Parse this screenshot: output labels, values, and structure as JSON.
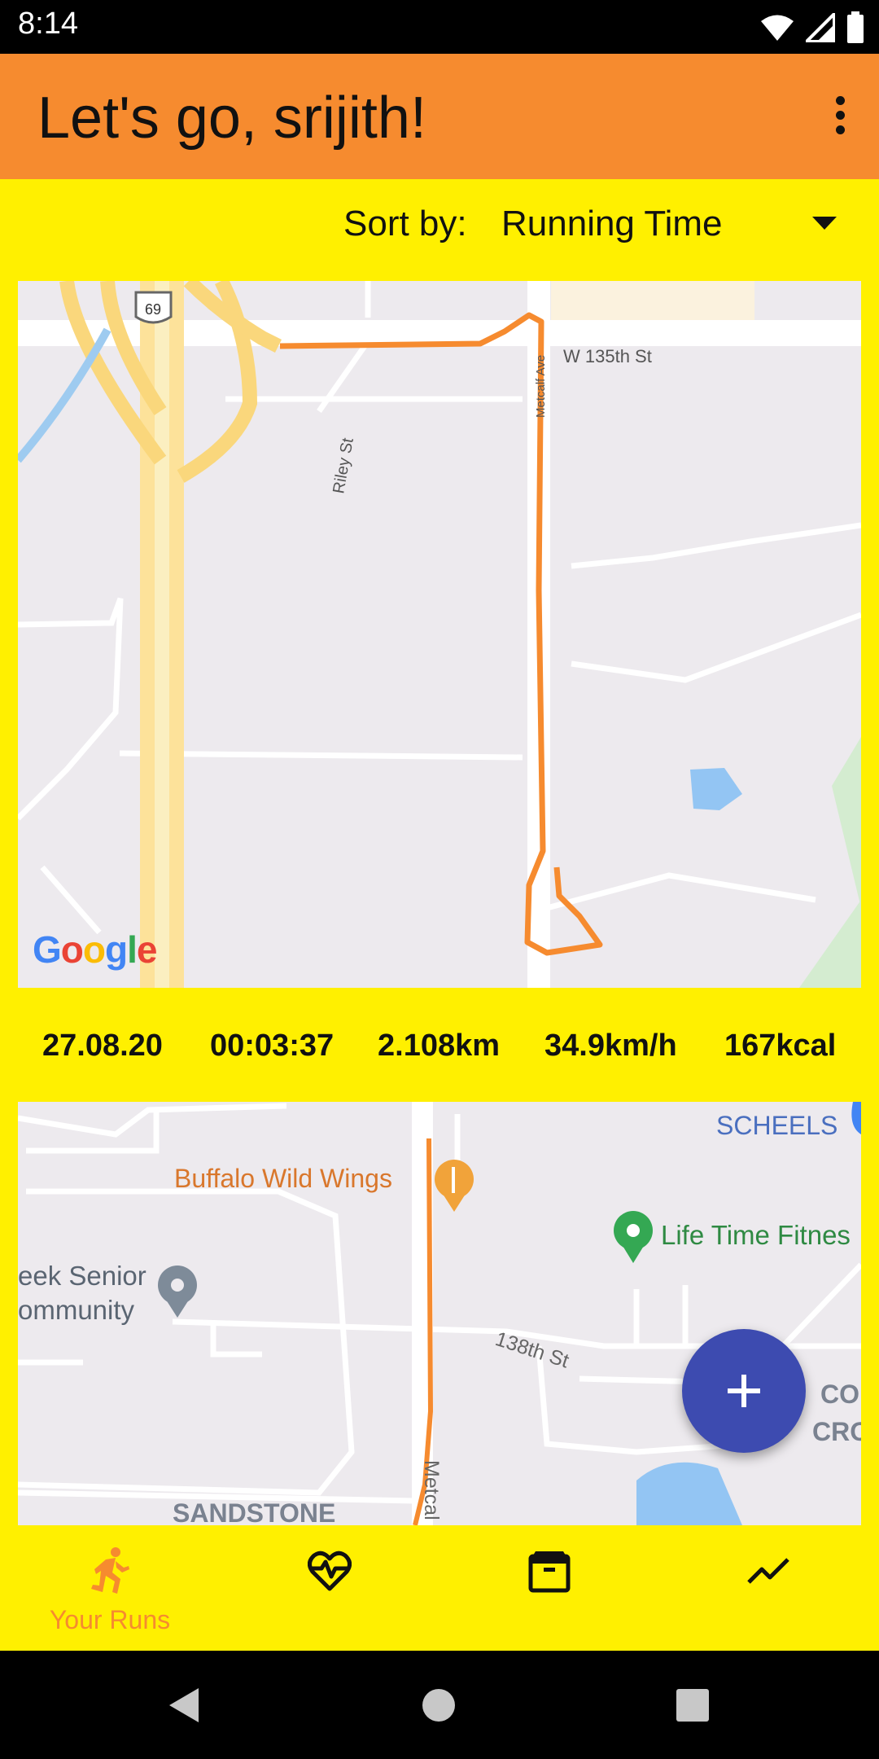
{
  "status_bar": {
    "time": "8:14"
  },
  "app_bar": {
    "title": "Let's go, srijith!"
  },
  "sort": {
    "label": "Sort by:",
    "value": "Running Time"
  },
  "run1": {
    "map_labels": {
      "street_1": "W 135th St",
      "street_2": "Metcalf Ave",
      "street_3": "Riley St",
      "highway": "69"
    },
    "logo": "Google",
    "stats": {
      "date": "27.08.20",
      "duration": "00:03:37",
      "distance": "2.108km",
      "speed": "34.9km/h",
      "calories": "167kcal"
    }
  },
  "run2": {
    "map_labels": {
      "poi_1": "SCHEELS",
      "poi_2": "Buffalo Wild Wings",
      "poi_3": "Life Time Fitnes",
      "poi_4_line1": "eek Senior",
      "poi_4_line2": "ommunity",
      "street_1": "138th St",
      "street_2": "Metcal",
      "area_1": "SANDSTONE",
      "area_2_line1": "COR",
      "area_2_line2": "CROSS"
    }
  },
  "bottom_nav": {
    "items": [
      {
        "label": "Your Runs",
        "icon": "running-icon",
        "active": true
      },
      {
        "label": "",
        "icon": "heart-pulse-icon",
        "active": false
      },
      {
        "label": "",
        "icon": "archive-icon",
        "active": false
      },
      {
        "label": "",
        "icon": "trending-icon",
        "active": false
      }
    ]
  },
  "colors": {
    "primary": "#F68B2F",
    "background": "#FFF000",
    "fab": "#3D4BB0",
    "route": "#F68B2F"
  }
}
